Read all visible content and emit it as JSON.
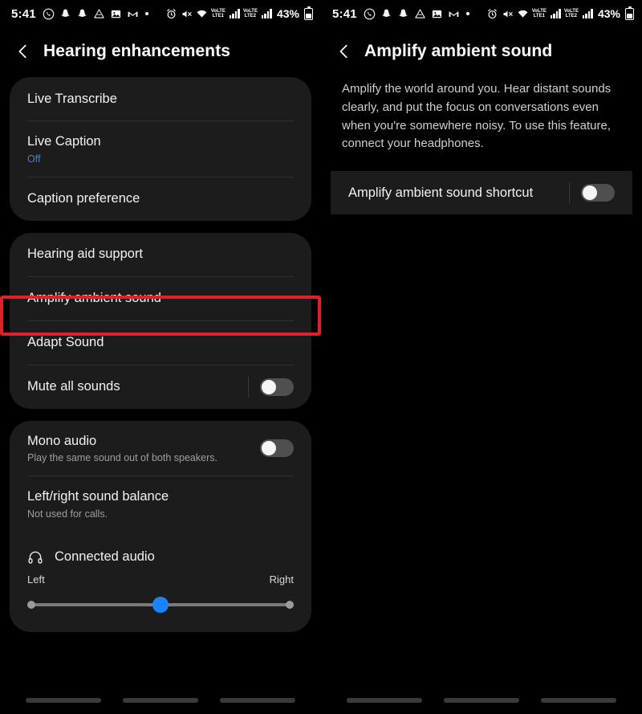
{
  "status_bar": {
    "time": "5:41",
    "left_icons": [
      "whatsapp-icon",
      "snapchat-icon",
      "snapchat-icon",
      "google-drive-icon",
      "gallery-icon",
      "gmail-icon",
      "more-dot-icon"
    ],
    "right_icons": [
      "alarm-icon",
      "mute-icon",
      "wifi-icon",
      "volte-lte1-signal-icon",
      "volte-lte2-signal-icon"
    ],
    "volte_labels": {
      "voice": "VoLTE",
      "sim1": "LTE1",
      "sim2": "LTE2"
    },
    "battery_percent": "43%"
  },
  "left_screen": {
    "title": "Hearing enhancements",
    "back_icon": "back-chevron-icon",
    "card1": {
      "rows": [
        {
          "title": "Live Transcribe",
          "sub": ""
        },
        {
          "title": "Live Caption",
          "sub": "Off",
          "sub_style": "blue"
        },
        {
          "title": "Caption preference",
          "sub": ""
        }
      ]
    },
    "card2": {
      "rows": [
        {
          "title": "Hearing aid support",
          "sub": "",
          "toggle": null
        },
        {
          "title": "Amplify ambient sound",
          "sub": "",
          "toggle": null,
          "highlighted": true
        },
        {
          "title": "Adapt Sound",
          "sub": "",
          "toggle": null
        },
        {
          "title": "Mute all sounds",
          "sub": "",
          "toggle": "off"
        }
      ]
    },
    "card3": {
      "mono_audio": {
        "title": "Mono audio",
        "sub": "Play the same sound out of both speakers.",
        "toggle": "off"
      },
      "balance": {
        "title": "Left/right sound balance",
        "sub": "Not used for calls."
      },
      "connected_audio": {
        "label": "Connected audio",
        "icon": "headphones-icon"
      },
      "slider": {
        "left_label": "Left",
        "right_label": "Right",
        "value_percent": 50
      }
    }
  },
  "right_screen": {
    "title": "Amplify ambient sound",
    "back_icon": "back-chevron-icon",
    "description": "Amplify the world around you. Hear distant sounds clearly, and put the focus on conversations even when you're somewhere noisy. To use this feature, connect your headphones.",
    "shortcut_row": {
      "title": "Amplify ambient sound shortcut",
      "toggle": "off",
      "highlighted": true
    }
  },
  "colors": {
    "highlight_red": "#e51f29",
    "accent_blue": "#1a84ff",
    "link_blue": "#4a7fd4",
    "card_bg": "#1c1c1c",
    "page_bg": "#000000"
  },
  "nav_bar": {
    "buttons": [
      "recents-button",
      "home-button",
      "back-button"
    ]
  }
}
